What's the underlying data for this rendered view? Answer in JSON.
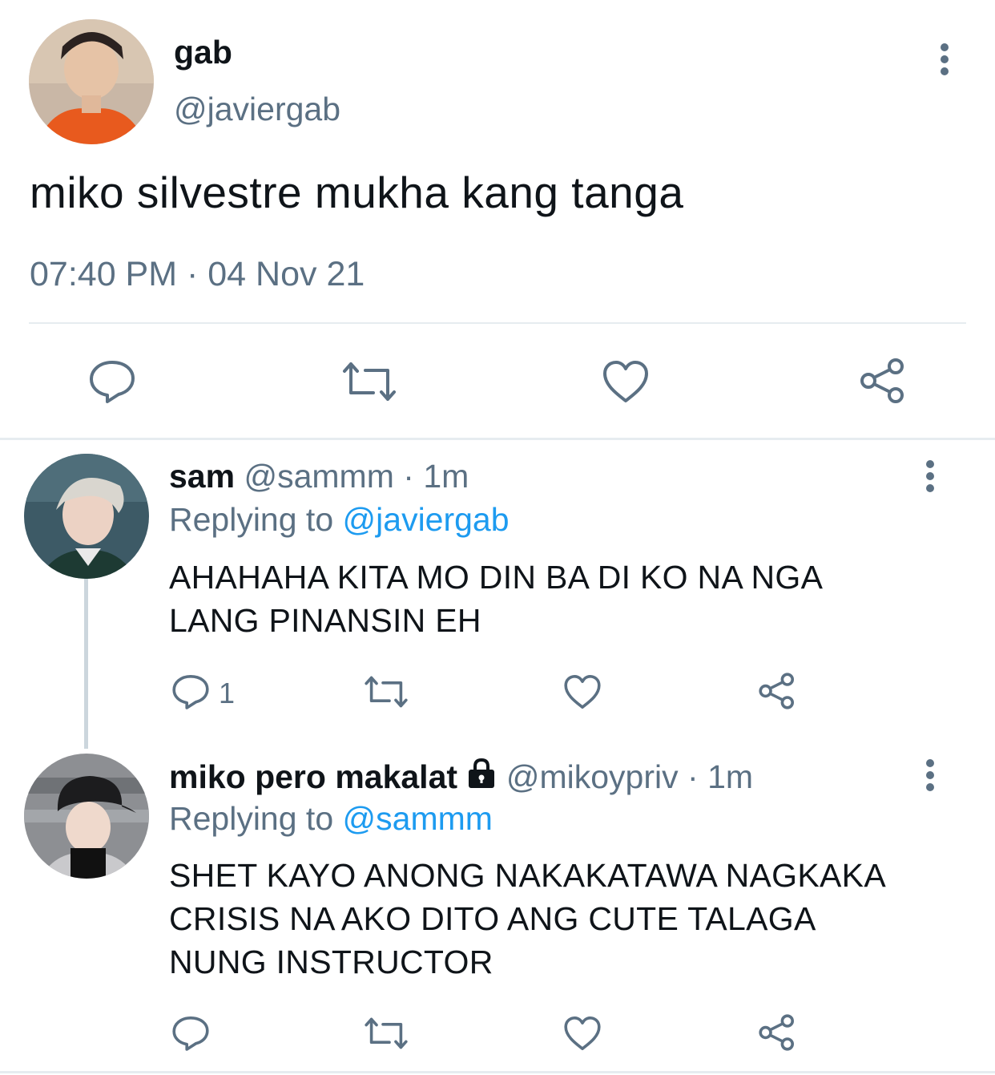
{
  "main_tweet": {
    "display_name": "gab",
    "handle": "@javiergab",
    "text": "miko silvestre mukha kang tanga",
    "timestamp": "07:40 PM · 04 Nov 21",
    "icons": [
      "reply-icon",
      "retweet-icon",
      "like-icon",
      "share-icon"
    ]
  },
  "replies": [
    {
      "display_name": "sam",
      "handle": "@sammm",
      "separator": "·",
      "time": "1m",
      "replying_prefix": "Replying to",
      "replying_to": "@javiergab",
      "text": "AHAHAHA KITA MO DIN BA DI KO NA NGA\nLANG PINANSIN EH",
      "reply_count": "1"
    },
    {
      "display_name": "miko pero makalat",
      "protected": true,
      "handle": "@mikoypriv",
      "separator": "·",
      "time": "1m",
      "replying_prefix": "Replying to",
      "replying_to": "@sammm",
      "text": "SHET KAYO ANONG NAKAKATAWA NAGKAKA\nCRISIS NA AKO DITO ANG CUTE TALAGA\nNUNG INSTRUCTOR",
      "reply_count": ""
    }
  ],
  "colors": {
    "link": "#1d9bf0",
    "muted": "#5b7083",
    "icon": "#5b7083",
    "divider": "#e6ecf0"
  }
}
